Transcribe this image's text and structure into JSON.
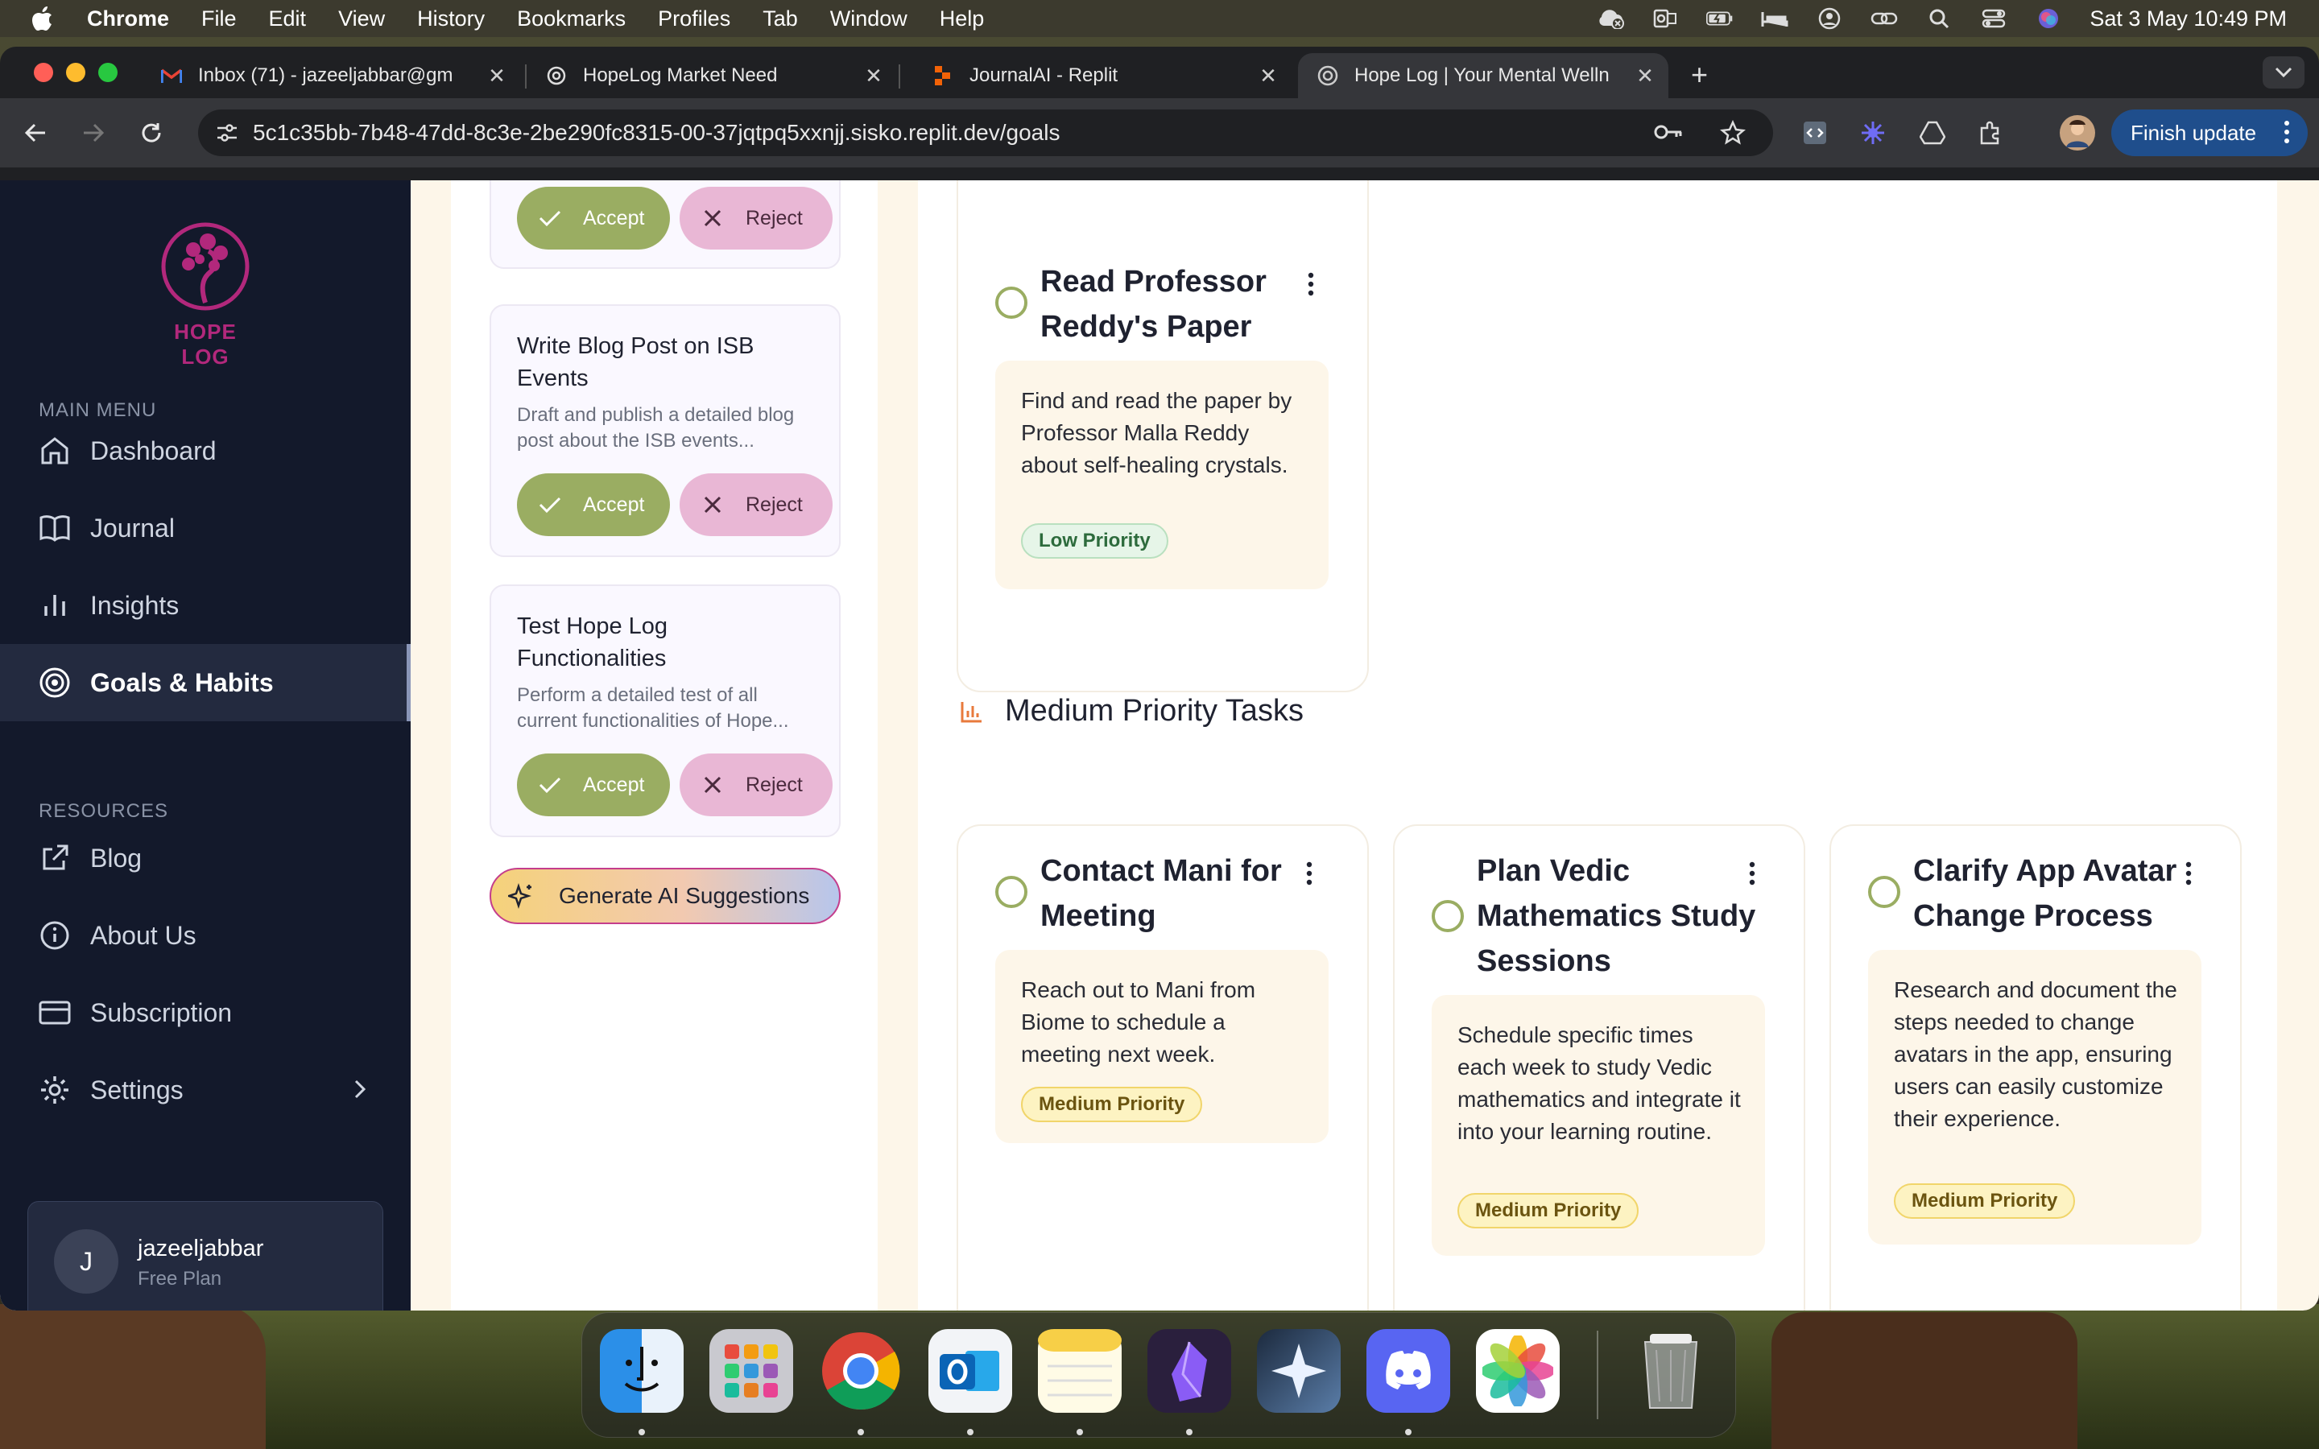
{
  "menubar": {
    "app": "Chrome",
    "items": [
      "File",
      "Edit",
      "View",
      "History",
      "Bookmarks",
      "Profiles",
      "Tab",
      "Window",
      "Help"
    ],
    "datetime": "Sat 3 May  10:49 PM"
  },
  "tabs": [
    {
      "title": "Inbox (71) - jazeeljabbar@gm",
      "favicon": "gmail-icon"
    },
    {
      "title": "HopeLog Market Need",
      "favicon": "openai-icon"
    },
    {
      "title": "JournalAI - Replit",
      "favicon": "replit-icon"
    },
    {
      "title": "Hope Log | Your Mental Welln",
      "favicon": "globe-icon"
    }
  ],
  "omnibox": {
    "url": "5c1c35bb-7b48-47dd-8c3e-2be290fc8315-00-37jqtpq5xxnjj.sisko.replit.dev/goals"
  },
  "toolbar": {
    "finish_update": "Finish update"
  },
  "sidebar": {
    "logo_text": "HOPE LOG",
    "main_menu_label": "MAIN MENU",
    "resources_label": "RESOURCES",
    "main_items": [
      {
        "label": "Dashboard",
        "icon": "home-icon"
      },
      {
        "label": "Journal",
        "icon": "book-icon"
      },
      {
        "label": "Insights",
        "icon": "bar-chart-icon"
      },
      {
        "label": "Goals & Habits",
        "icon": "target-icon",
        "active": true
      }
    ],
    "resource_items": [
      {
        "label": "Blog",
        "icon": "external-link-icon"
      },
      {
        "label": "About Us",
        "icon": "info-icon"
      },
      {
        "label": "Subscription",
        "icon": "credit-card-icon"
      },
      {
        "label": "Settings",
        "icon": "gear-icon"
      }
    ],
    "user": {
      "initial": "J",
      "name": "jazeeljabbar",
      "plan": "Free Plan"
    }
  },
  "suggestions": {
    "accept_label": "Accept",
    "reject_label": "Reject",
    "cards": [
      {
        "title": "Write Blog Post on ISB Events",
        "desc": "Draft and publish a detailed blog post about the ISB events..."
      },
      {
        "title": "Test Hope Log Functionalities",
        "desc": "Perform a detailed test of all current functionalities of Hope..."
      }
    ],
    "generate_label": "Generate AI Suggestions"
  },
  "goals": {
    "low_task": {
      "title": "Read Professor Reddy's Paper",
      "desc": "Find and read the paper by Professor Malla Reddy about self-healing crystals.",
      "priority": "Low Priority"
    },
    "medium_heading": "Medium Priority Tasks",
    "medium_tasks": [
      {
        "title": "Contact Mani for Meeting",
        "desc": "Reach out to Mani from Biome to schedule a meeting next week.",
        "priority": "Medium Priority"
      },
      {
        "title": "Plan Vedic Mathematics Study Sessions",
        "desc": "Schedule specific times each week to study Vedic mathematics and integrate it into your learning routine.",
        "priority": "Medium Priority"
      },
      {
        "title": "Clarify App Avatar Change Process",
        "desc": "Research and document the steps needed to change avatars in the app, ensuring users can easily customize their experience.",
        "priority": "Medium Priority"
      }
    ]
  },
  "dock": [
    "Finder",
    "Launchpad",
    "Chrome",
    "Outlook",
    "Notes",
    "Obsidian",
    "Perplexity",
    "Discord",
    "Photos",
    "Trash"
  ],
  "colors": {
    "accent_green": "#9aad62",
    "brand_pink": "#b2287c",
    "sidebar_bg": "#13192b"
  }
}
